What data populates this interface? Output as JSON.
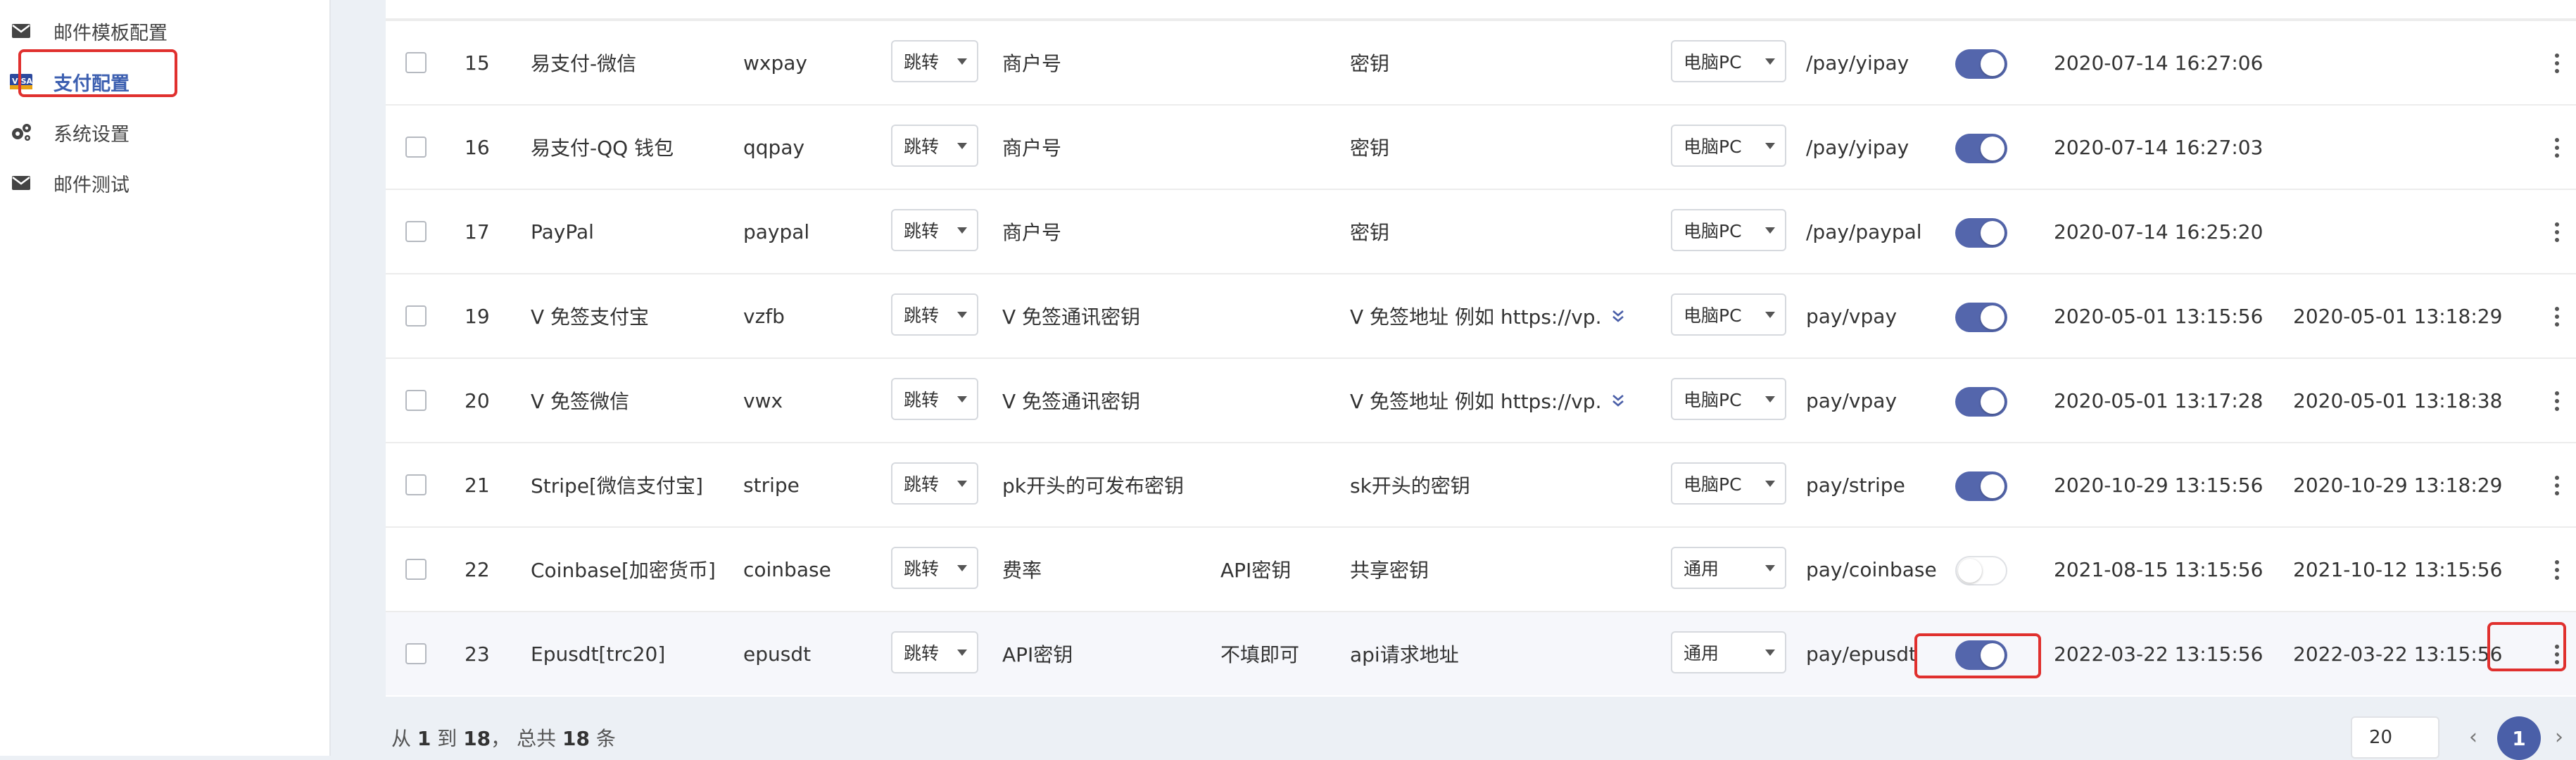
{
  "sidebar": {
    "items": [
      {
        "label": "邮件模板配置",
        "icon": "envelope-icon"
      },
      {
        "label": "支付配置",
        "icon": "visa-card-icon"
      },
      {
        "label": "系统设置",
        "icon": "gears-icon"
      },
      {
        "label": "邮件测试",
        "icon": "envelope-icon"
      }
    ]
  },
  "table": {
    "rows": [
      {
        "id": "15",
        "name": "易支付-微信",
        "check": "wxpay",
        "method": "跳转",
        "merchant": "商户号",
        "extra": "",
        "secret": "密钥",
        "secret_expand": false,
        "client": "电脑PC",
        "route": "/pay/yipay",
        "enabled": true,
        "created": "2020-07-14 16:27:06",
        "updated": ""
      },
      {
        "id": "16",
        "name": "易支付-QQ 钱包",
        "check": "qqpay",
        "method": "跳转",
        "merchant": "商户号",
        "extra": "",
        "secret": "密钥",
        "secret_expand": false,
        "client": "电脑PC",
        "route": "/pay/yipay",
        "enabled": true,
        "created": "2020-07-14 16:27:03",
        "updated": ""
      },
      {
        "id": "17",
        "name": "PayPal",
        "check": "paypal",
        "method": "跳转",
        "merchant": "商户号",
        "extra": "",
        "secret": "密钥",
        "secret_expand": false,
        "client": "电脑PC",
        "route": "/pay/paypal",
        "enabled": true,
        "created": "2020-07-14 16:25:20",
        "updated": ""
      },
      {
        "id": "19",
        "name": "V 免签支付宝",
        "check": "vzfb",
        "method": "跳转",
        "merchant": "V 免签通讯密钥",
        "extra": "",
        "secret": "V 免签地址 例如 https://vp...",
        "secret_expand": true,
        "client": "电脑PC",
        "route": "pay/vpay",
        "enabled": true,
        "created": "2020-05-01 13:15:56",
        "updated": "2020-05-01 13:18:29"
      },
      {
        "id": "20",
        "name": "V 免签微信",
        "check": "vwx",
        "method": "跳转",
        "merchant": "V 免签通讯密钥",
        "extra": "",
        "secret": "V 免签地址 例如 https://vp...",
        "secret_expand": true,
        "client": "电脑PC",
        "route": "pay/vpay",
        "enabled": true,
        "created": "2020-05-01 13:17:28",
        "updated": "2020-05-01 13:18:38"
      },
      {
        "id": "21",
        "name": "Stripe[微信支付宝]",
        "check": "stripe",
        "method": "跳转",
        "merchant": "pk开头的可发布密钥",
        "extra": "",
        "secret": "sk开头的密钥",
        "secret_expand": false,
        "client": "电脑PC",
        "route": "pay/stripe",
        "enabled": true,
        "created": "2020-10-29 13:15:56",
        "updated": "2020-10-29 13:18:29"
      },
      {
        "id": "22",
        "name": "Coinbase[加密货币]",
        "check": "coinbase",
        "method": "跳转",
        "merchant": "费率",
        "extra": "API密钥",
        "secret": "共享密钥",
        "secret_expand": false,
        "client": "通用",
        "route": "pay/coinbase",
        "enabled": false,
        "created": "2021-08-15 13:15:56",
        "updated": "2021-10-12 13:15:56"
      },
      {
        "id": "23",
        "name": "Epusdt[trc20]",
        "check": "epusdt",
        "method": "跳转",
        "merchant": "API密钥",
        "extra": "不填即可",
        "secret": "api请求地址",
        "secret_expand": false,
        "client": "通用",
        "route": "pay/epusdt",
        "enabled": true,
        "created": "2022-03-22 13:15:56",
        "updated": "2022-03-22 13:15:56"
      }
    ]
  },
  "pagination": {
    "from_text": "从 ",
    "from": "1",
    "to_text": " 到 ",
    "to": "18",
    "total_text": "， 总共 ",
    "total": "18",
    "unit": " 条",
    "page_size": "20",
    "prev": "‹",
    "current": "1",
    "next": "›"
  },
  "colors": {
    "accent": "#5466ac",
    "highlight": "#e0302e"
  }
}
